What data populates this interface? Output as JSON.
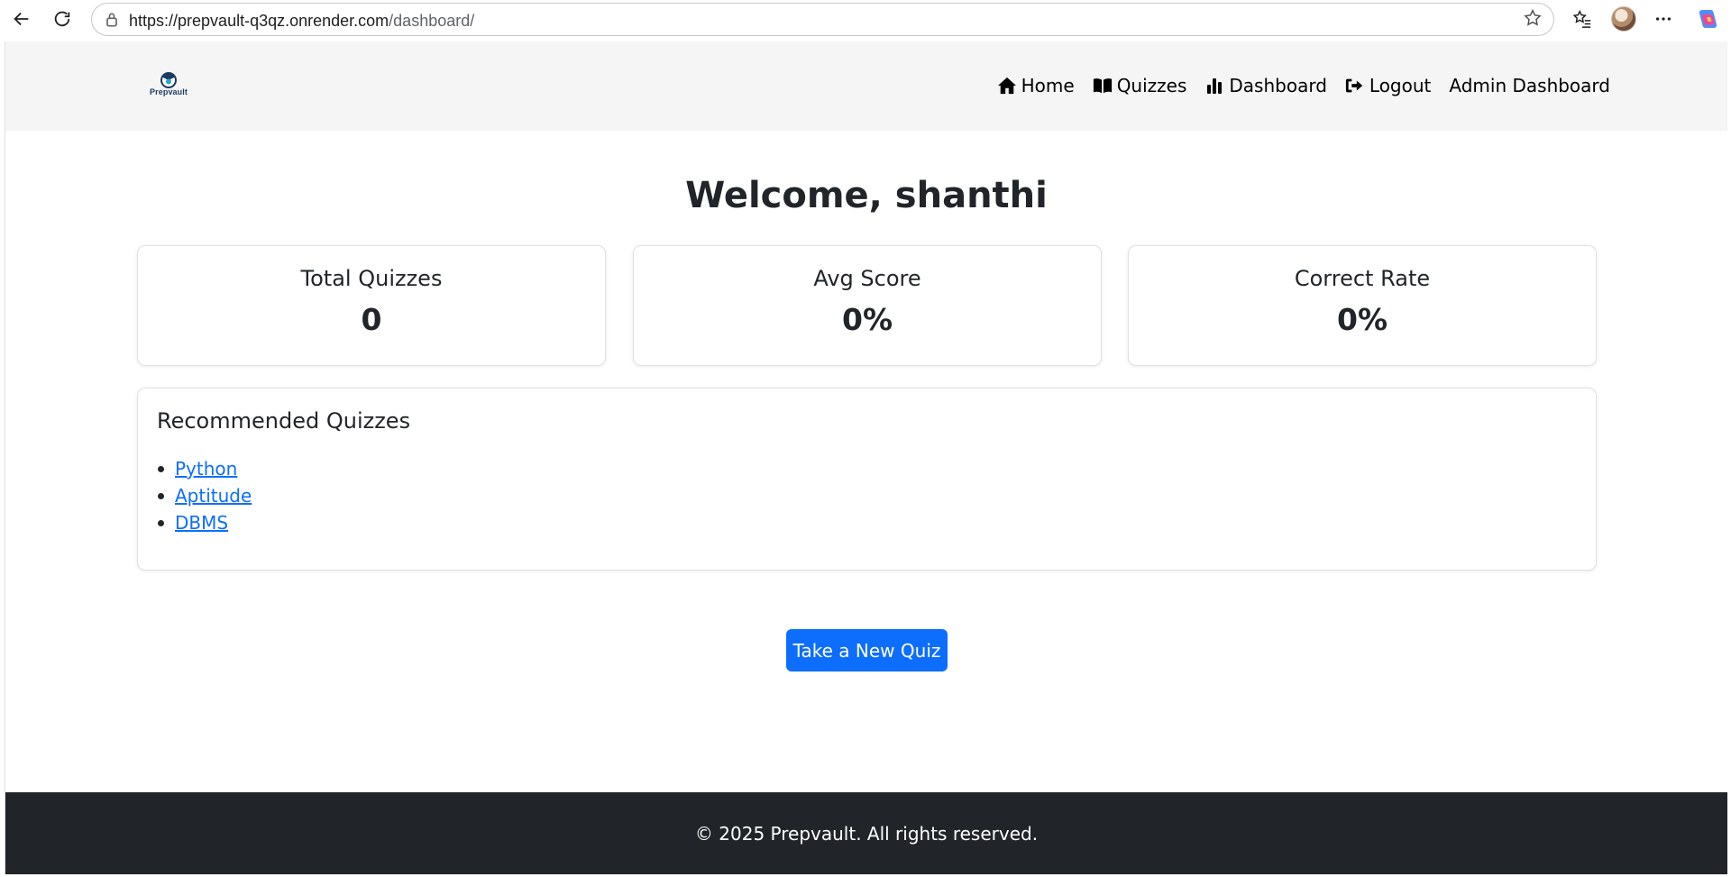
{
  "browser": {
    "url_host": "https://prepvault-q3qz.onrender.com",
    "url_path": "/dashboard/"
  },
  "navbar": {
    "brand": "Prepvault",
    "links": [
      {
        "label": "Home",
        "icon": "home-icon"
      },
      {
        "label": "Quizzes",
        "icon": "book-icon"
      },
      {
        "label": "Dashboard",
        "icon": "chart-bar-icon"
      },
      {
        "label": "Logout",
        "icon": "logout-icon"
      },
      {
        "label": "Admin Dashboard",
        "icon": ""
      }
    ]
  },
  "main": {
    "welcome": "Welcome, shanthi",
    "stats": [
      {
        "title": "Total Quizzes",
        "value": "0"
      },
      {
        "title": "Avg Score",
        "value": "0%"
      },
      {
        "title": "Correct Rate",
        "value": "0%"
      }
    ],
    "recommended": {
      "title": "Recommended Quizzes",
      "items": [
        "Python",
        "Aptitude",
        "DBMS"
      ]
    },
    "new_quiz_button": "Take a New Quiz"
  },
  "footer": {
    "text": "© 2025 Prepvault. All rights reserved."
  },
  "colors": {
    "primary": "#0d6efd",
    "navbar_bg": "#f5f5f5",
    "footer_bg": "#212529",
    "text": "#212529"
  }
}
